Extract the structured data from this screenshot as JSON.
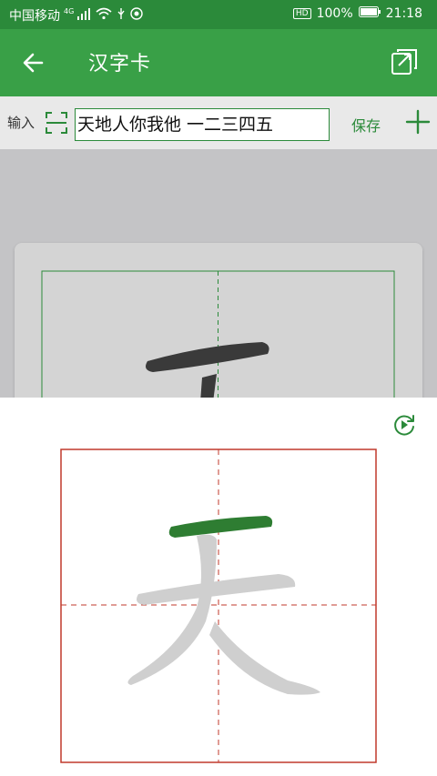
{
  "status": {
    "carrier": "中国移动",
    "network": "4G",
    "battery": "100%",
    "time": "21:18",
    "hd": "HD"
  },
  "appbar": {
    "title": "汉字卡"
  },
  "input": {
    "label": "输入",
    "value": "天地人你我他 一二三四五",
    "save_label": "保存"
  },
  "practice": {
    "character": "天",
    "active_stroke": 1
  },
  "colors": {
    "primary": "#39a047",
    "primary_dark": "#2b8a3a",
    "grid_red": "#c0392b",
    "stroke_active": "#2e7d32",
    "stroke_pending": "#cfcfcf"
  }
}
